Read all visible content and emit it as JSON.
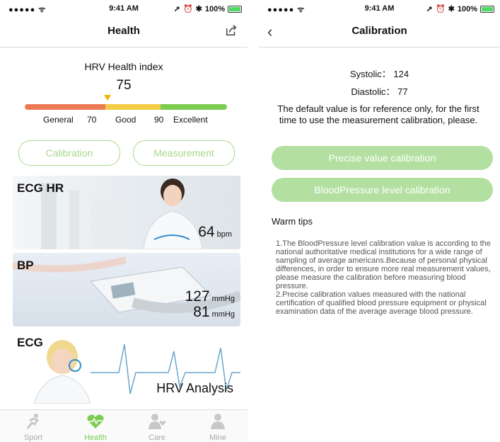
{
  "status_left": {
    "carrier": "●●●●● ",
    "time": "9:41 AM",
    "battery": "100%"
  },
  "status_right": {
    "carrier": "●●●●● ",
    "time": "9:41 AM",
    "battery": "100%"
  },
  "left": {
    "title": "Health",
    "hrv_title": "HRV Health index",
    "hrv_value": "75",
    "hrv_level": 0.41,
    "scale": {
      "general": "General",
      "v70": "70",
      "good": "Good",
      "v90": "90",
      "excellent": "Excellent"
    },
    "colors": {
      "red": "#ee7a55",
      "yellow": "#f4cc45",
      "green": "#7ccc52",
      "accent": "#a6d98b"
    },
    "calibration_button": "Calibration",
    "measurement_button": "Measurement",
    "ecg_hr": {
      "label": "ECG HR",
      "value": "64",
      "unit": "bpm"
    },
    "bp": {
      "label": "BP",
      "systolic": "127",
      "diastolic": "81",
      "unit": "mmHg"
    },
    "ecg": {
      "label": "ECG",
      "caption": "HRV Analysis"
    },
    "tabs": [
      {
        "label": "Sport",
        "icon": "runner-icon"
      },
      {
        "label": "Health",
        "icon": "heart-pulse-icon"
      },
      {
        "label": "Care",
        "icon": "care-icon"
      },
      {
        "label": "Mine",
        "icon": "person-icon"
      }
    ]
  },
  "right": {
    "title": "Calibration",
    "systolic_label": "Systolic：",
    "systolic_value": "124",
    "diastolic_label": "Diastolic：",
    "diastolic_value": "77",
    "note": "The default value is for reference only, for the first time to use the measurement calibration, please.",
    "precise_button": "Precise value calibration",
    "level_button": "BloodPressure level calibration",
    "tips_title": "Warm tips",
    "tip1": "1.The BloodPressure level calibration value is according to the national authoritative medical institutions for a wide range of sampling of average americans.Because of personal physical differences, in order to ensure more real measurement values, please measure the calibration before measuring blood pressure.",
    "tip2": "2.Precise calibration values measured with the national certification of qualified blood pressure equipment or physical examination data of the average average blood pressure."
  }
}
